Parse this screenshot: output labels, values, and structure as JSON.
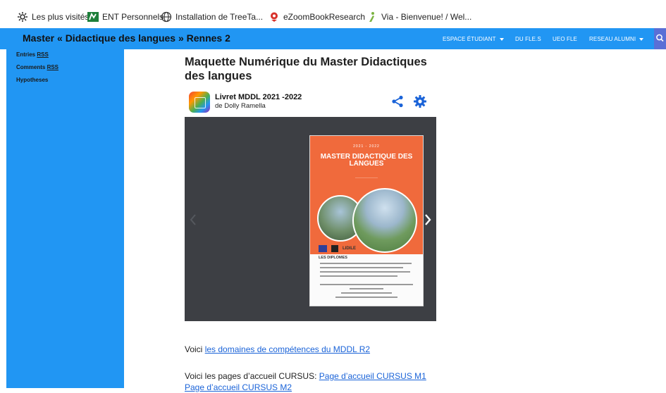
{
  "bookmarks": [
    {
      "label": "Les plus visités",
      "icon": "gear-icon"
    },
    {
      "label": "ENT Personnels",
      "icon": "ent-logo-icon"
    },
    {
      "label": "Installation de TreeTa...",
      "icon": "globe-icon"
    },
    {
      "label": "eZoomBookResearch",
      "icon": "ezoom-logo-icon"
    },
    {
      "label": "Via - Bienvenue! / Wel...",
      "icon": "via-logo-icon"
    }
  ],
  "navbar": {
    "site_title": "Master « Didactique des langues » Rennes 2",
    "menu": [
      {
        "label": "ESPACE ÉTUDIANT",
        "has_dropdown": true
      },
      {
        "label": "DU FLE.S",
        "has_dropdown": false
      },
      {
        "label": "UEO FLE",
        "has_dropdown": false
      },
      {
        "label": "RESEAU ALUMNI",
        "has_dropdown": true
      }
    ],
    "search_icon": "search-icon",
    "color": "#2196f3"
  },
  "sidebar": {
    "links": [
      {
        "text": "Entries ",
        "rss": "RSS"
      },
      {
        "text": "Comments ",
        "rss": "RSS"
      },
      {
        "text": "Hypotheses",
        "rss": ""
      }
    ]
  },
  "main": {
    "title": "Maquette Numérique du Master Didactiques des langues",
    "embed": {
      "title": "Livret MDDL 2021 -2022",
      "author": "de Dolly Ramella",
      "accent": "#1a63d8"
    },
    "book": {
      "year": "2021 - 2022",
      "title": "MASTER DIDACTIQUE DES LANGUES",
      "section": "LES DIPLOMES",
      "logo_text": "LIDILE"
    },
    "text1_prefix": "Voici ",
    "text1_link": "les  domaines de compétences du MDDL R2",
    "text2_prefix": "Voici les pages d’accueil CURSUS:  ",
    "text2_link1": "Page d’accueil CURSUS M1",
    "text2_link2": "Page d’accueil CURSUS M2"
  }
}
